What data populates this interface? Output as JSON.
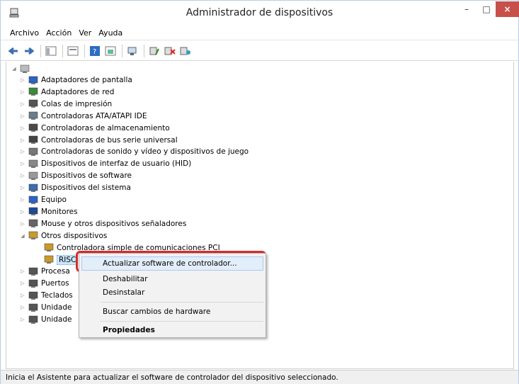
{
  "window": {
    "title": "Administrador de dispositivos",
    "close_glyph": "×",
    "min_glyph": "–",
    "max_glyph": "□"
  },
  "menu": [
    "Archivo",
    "Acción",
    "Ver",
    "Ayuda"
  ],
  "toolbar": {
    "icons": [
      "back-arrow-icon",
      "forward-arrow-icon",
      "console-tree-icon",
      "properties-icon",
      "help-icon",
      "show-hide-icon",
      "update-driver-icon",
      "uninstall-icon",
      "disable-icon",
      "scan-hardware-icon"
    ]
  },
  "tree": {
    "categories": [
      "Adaptadores de pantalla",
      "Adaptadores de red",
      "Colas de impresión",
      "Controladoras ATA/ATAPI IDE",
      "Controladoras de almacenamiento",
      "Controladoras de bus serie universal",
      "Controladoras de sonido y vídeo y dispositivos de juego",
      "Dispositivos de interfaz de usuario (HID)",
      "Dispositivos de software",
      "Dispositivos del sistema",
      "Equipo",
      "Monitores",
      "Mouse y otros dispositivos señaladores",
      "Otros dispositivos"
    ],
    "other_children": [
      "Controladora simple de comunicaciones PCI",
      "RISC"
    ],
    "after": [
      "Procesa",
      "Puertos",
      "Teclados",
      "Unidade",
      "Unidade"
    ]
  },
  "context_menu": {
    "items": [
      "Actualizar software de controlador...",
      "Deshabilitar",
      "Desinstalar",
      "Buscar cambios de hardware",
      "Propiedades"
    ]
  },
  "status": "Inicia el Asistente para actualizar el software de controlador del dispositivo seleccionado."
}
